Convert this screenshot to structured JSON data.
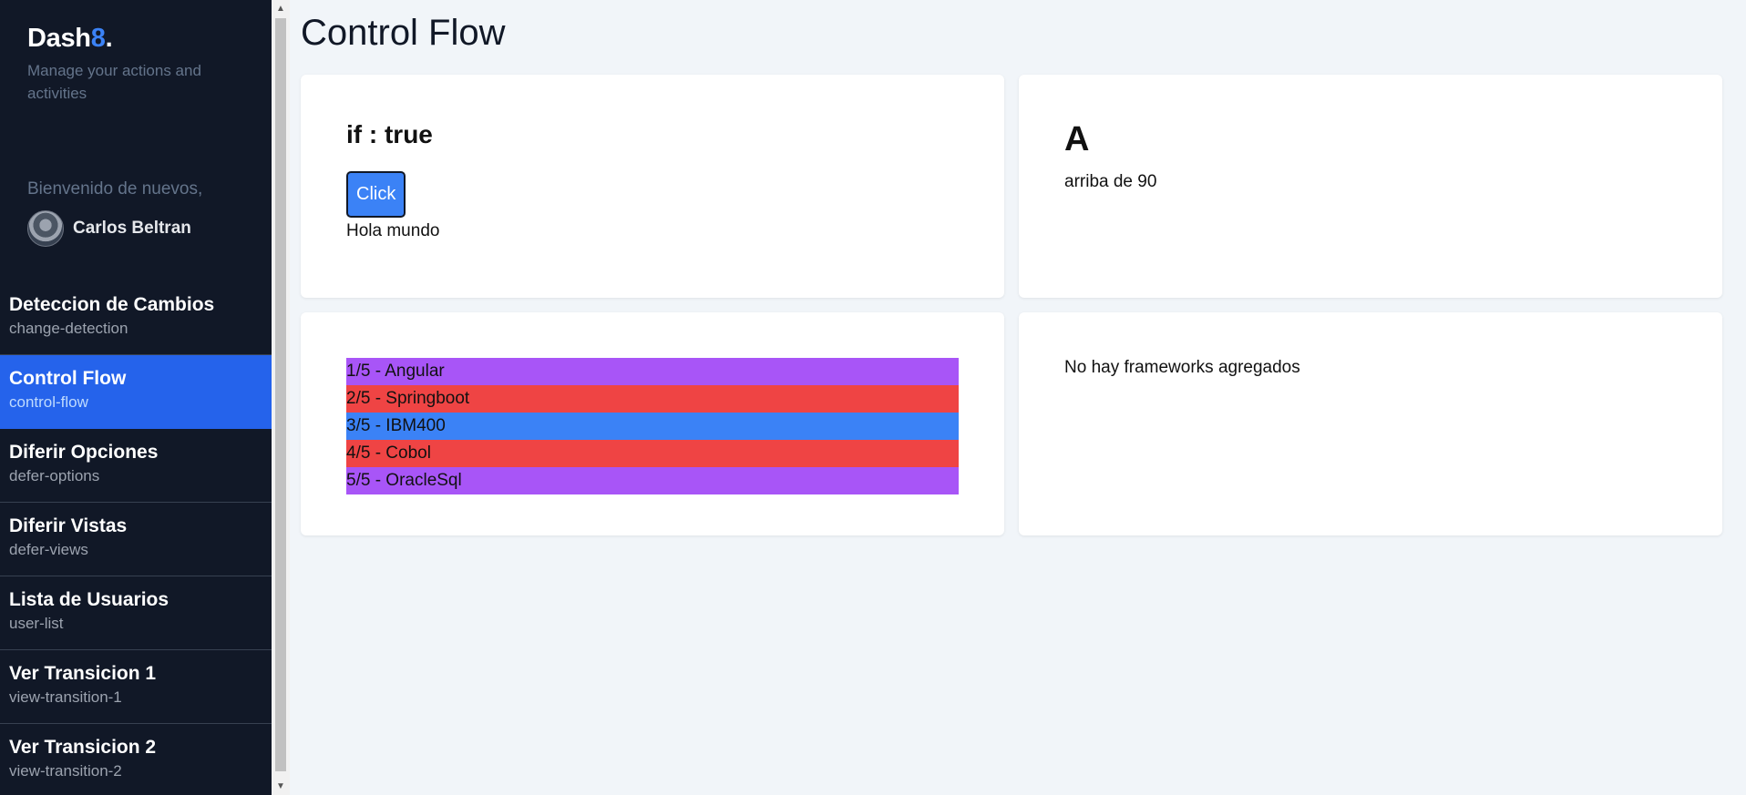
{
  "sidebar": {
    "logo_main": "Dash",
    "logo_accent": "8",
    "logo_dot": ".",
    "subtitle": "Manage your actions and activities",
    "welcome": "Bienvenido de nuevos,",
    "user_name": "Carlos Beltran",
    "nav": [
      {
        "title": "Deteccion de Cambios",
        "path": "change-detection",
        "active": false
      },
      {
        "title": "Control Flow",
        "path": "control-flow",
        "active": true
      },
      {
        "title": "Diferir Opciones",
        "path": "defer-options",
        "active": false
      },
      {
        "title": "Diferir Vistas",
        "path": "defer-views",
        "active": false
      },
      {
        "title": "Lista de Usuarios",
        "path": "user-list",
        "active": false
      },
      {
        "title": "Ver Transicion 1",
        "path": "view-transition-1",
        "active": false
      },
      {
        "title": "Ver Transicion 2",
        "path": "view-transition-2",
        "active": false
      }
    ]
  },
  "main": {
    "title": "Control Flow",
    "if_card": {
      "heading": "if : true",
      "button_label": "Click",
      "text": "Hola mundo"
    },
    "grade_card": {
      "grade": "A",
      "text": "arriba de 90"
    },
    "frameworks": [
      {
        "label": "1/5 - Angular",
        "color": "#a855f7"
      },
      {
        "label": "2/5 - Springboot",
        "color": "#ef4444"
      },
      {
        "label": "3/5 - IBM400",
        "color": "#3b82f6"
      },
      {
        "label": "4/5 - Cobol",
        "color": "#ef4444"
      },
      {
        "label": "5/5 - OracleSql",
        "color": "#a855f7"
      }
    ],
    "empty_card": {
      "text": "No hay frameworks agregados"
    }
  },
  "colors": {
    "sidebar_bg": "#111827",
    "active_nav": "#2563eb",
    "accent": "#3b82f6",
    "page_bg": "#f1f5f9"
  }
}
